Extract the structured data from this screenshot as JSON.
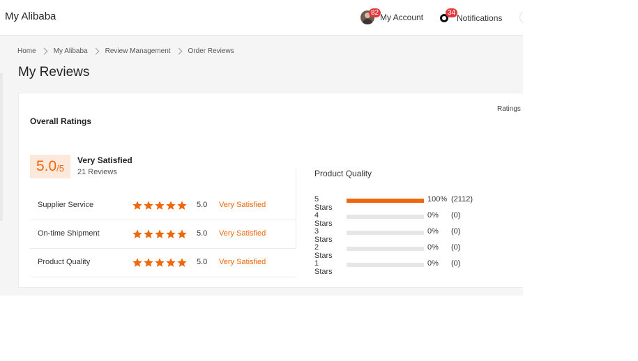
{
  "header": {
    "brand": "My Alibaba",
    "account_badge": "82",
    "account_label": "My Account",
    "notifications_badge": "34",
    "notifications_label": "Notifications"
  },
  "breadcrumb": [
    "Home",
    "My Alibaba",
    "Review Management",
    "Order Reviews"
  ],
  "page_title": "My Reviews",
  "panel": {
    "ratings_link": "Ratings I",
    "overall_title": "Overall Ratings",
    "score": "5.0",
    "score_denominator": "/5",
    "satisfaction": "Very Satisfied",
    "reviews_count": "21 Reviews",
    "rows": [
      {
        "label": "Supplier Service",
        "stars": 5,
        "value": "5.0",
        "text": "Very Satisfied"
      },
      {
        "label": "On-time Shipment",
        "stars": 5,
        "value": "5.0",
        "text": "Very Satisfied"
      },
      {
        "label": "Product Quality",
        "stars": 5,
        "value": "5.0",
        "text": "Very Satisfied"
      }
    ],
    "distribution_title": "Product Quality",
    "distribution": [
      {
        "label": "5 Stars",
        "fraction": 1.0,
        "percent": "100%",
        "count": "(2112)"
      },
      {
        "label": "4 Stars",
        "fraction": 0.0,
        "percent": "0%",
        "count": "(0)"
      },
      {
        "label": "3 Stars",
        "fraction": 0.0,
        "percent": "0%",
        "count": "(0)"
      },
      {
        "label": "2 Stars",
        "fraction": 0.0,
        "percent": "0%",
        "count": "(0)"
      },
      {
        "label": "1 Stars",
        "fraction": 0.0,
        "percent": "0%",
        "count": "(0)"
      }
    ]
  },
  "colors": {
    "accent": "#f0660a",
    "badge": "#e0393e",
    "score_bg": "#fde8dc",
    "bar_empty": "#e6e6e6"
  }
}
